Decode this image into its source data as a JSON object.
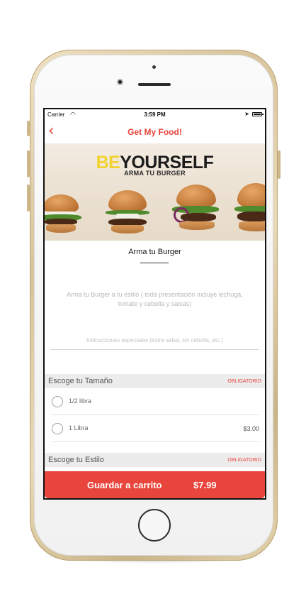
{
  "status_bar": {
    "carrier": "Carrier",
    "time": "3:59 PM"
  },
  "nav": {
    "title": "Get My Food!",
    "back_icon": "chevron-left-icon"
  },
  "hero": {
    "headline_accent": "BE",
    "headline": "YOURSELF",
    "subheadline": "ARMA TU BURGER"
  },
  "product": {
    "title": "Arma tu Burger",
    "description": "Arma tu Burger a tu estilo ( toda presentación incluye lechuga, tomate y cebolla y salsas)",
    "instructions_placeholder": "Instrucciones especiales (extra salsa, sin cebolla, etc.)"
  },
  "sections": [
    {
      "title": "Escoge tu Tamaño",
      "required_label": "OBLIGATORIO",
      "options": [
        {
          "label": "1/2 libra",
          "price": ""
        },
        {
          "label": "1 Libra",
          "price": "$3.00"
        }
      ]
    },
    {
      "title": "Escoge tu Estilo",
      "required_label": "OBLIGATORIO"
    }
  ],
  "cart": {
    "label": "Guardar a carrito",
    "total": "$7.99"
  },
  "colors": {
    "accent": "#e8453c",
    "hero_accent": "#f2d22e"
  }
}
